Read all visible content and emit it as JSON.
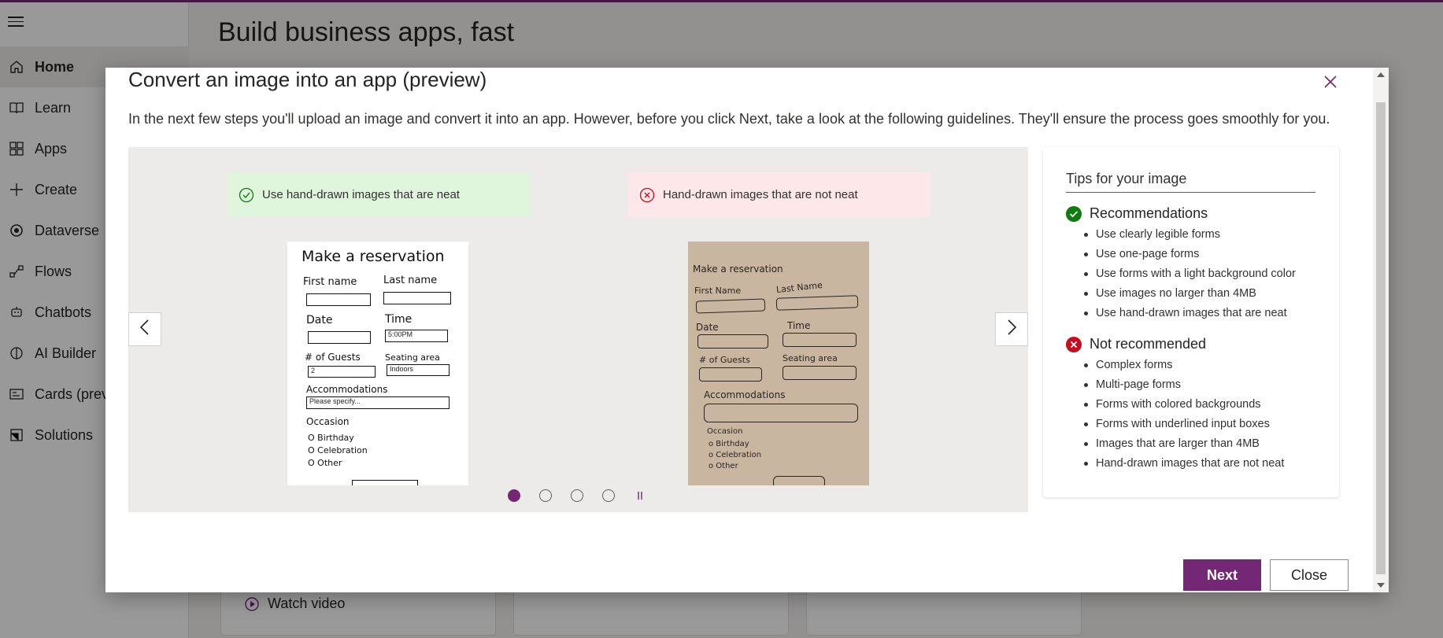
{
  "background": {
    "page_title": "Build business apps, fast",
    "nav_items": [
      {
        "label": "Home",
        "icon": "home-icon"
      },
      {
        "label": "Learn",
        "icon": "book-icon"
      },
      {
        "label": "Apps",
        "icon": "apps-icon"
      },
      {
        "label": "Create",
        "icon": "plus-icon"
      },
      {
        "label": "Dataverse",
        "icon": "dataverse-icon"
      },
      {
        "label": "Flows",
        "icon": "flow-icon"
      },
      {
        "label": "Chatbots",
        "icon": "chatbot-icon"
      },
      {
        "label": "AI Builder",
        "icon": "ai-builder-icon"
      },
      {
        "label": "Cards (previ",
        "icon": "cards-icon"
      },
      {
        "label": "Solutions",
        "icon": "solutions-icon"
      }
    ],
    "watch_video_label": "Watch video"
  },
  "modal": {
    "title": "Convert an image into an app (preview)",
    "description": "In the next few steps you'll upload an image and convert it into an app. However, before you click Next, take a look at the following guidelines. They'll ensure the process goes smoothly for you.",
    "carousel": {
      "good_banner": "Use hand-drawn images that are neat",
      "bad_banner": "Hand-drawn images that are not neat",
      "slide_count": 4,
      "active_slide": 1,
      "neat_sample": {
        "heading": "Make a reservation",
        "first_name": "First name",
        "last_name": "Last name",
        "date": "Date",
        "time": "Time",
        "time_value": "5:00PM",
        "guests": "# of Guests",
        "guests_value": "2",
        "seating": "Seating area",
        "seating_value": "Indoors",
        "accommodations": "Accommodations",
        "accommodations_placeholder": "Please specify...",
        "occasion": "Occasion",
        "options": [
          "O Birthday",
          "O Celebration",
          "O Other"
        ]
      },
      "messy_sample": {
        "heading": "Make a reservation",
        "first_name": "First Name",
        "last_name": "Last Name",
        "date": "Date",
        "time": "Time",
        "guests": "# of Guests",
        "seating": "Seating area",
        "accommodations": "Accommodations",
        "occasion": "Occasion",
        "options": [
          "o Birthday",
          "o Celebration",
          "o Other"
        ]
      }
    },
    "tips": {
      "title": "Tips for your image",
      "recommendations_title": "Recommendations",
      "recommendations": [
        "Use clearly legible forms",
        "Use one-page forms",
        "Use forms with a light background color",
        "Use images no larger than 4MB",
        "Use hand-drawn images that are neat"
      ],
      "not_recommended_title": "Not recommended",
      "not_recommended": [
        "Complex forms",
        "Multi-page forms",
        "Forms with colored backgrounds",
        "Forms with underlined input boxes",
        "Images that are larger than 4MB",
        "Hand-drawn images that are not neat"
      ]
    },
    "next_label": "Next",
    "close_label": "Close"
  },
  "colors": {
    "accent": "#742774",
    "success": "#107c10",
    "error": "#c50f1f",
    "good_banner_bg": "#dff6dd",
    "bad_banner_bg": "#fde7e9"
  }
}
